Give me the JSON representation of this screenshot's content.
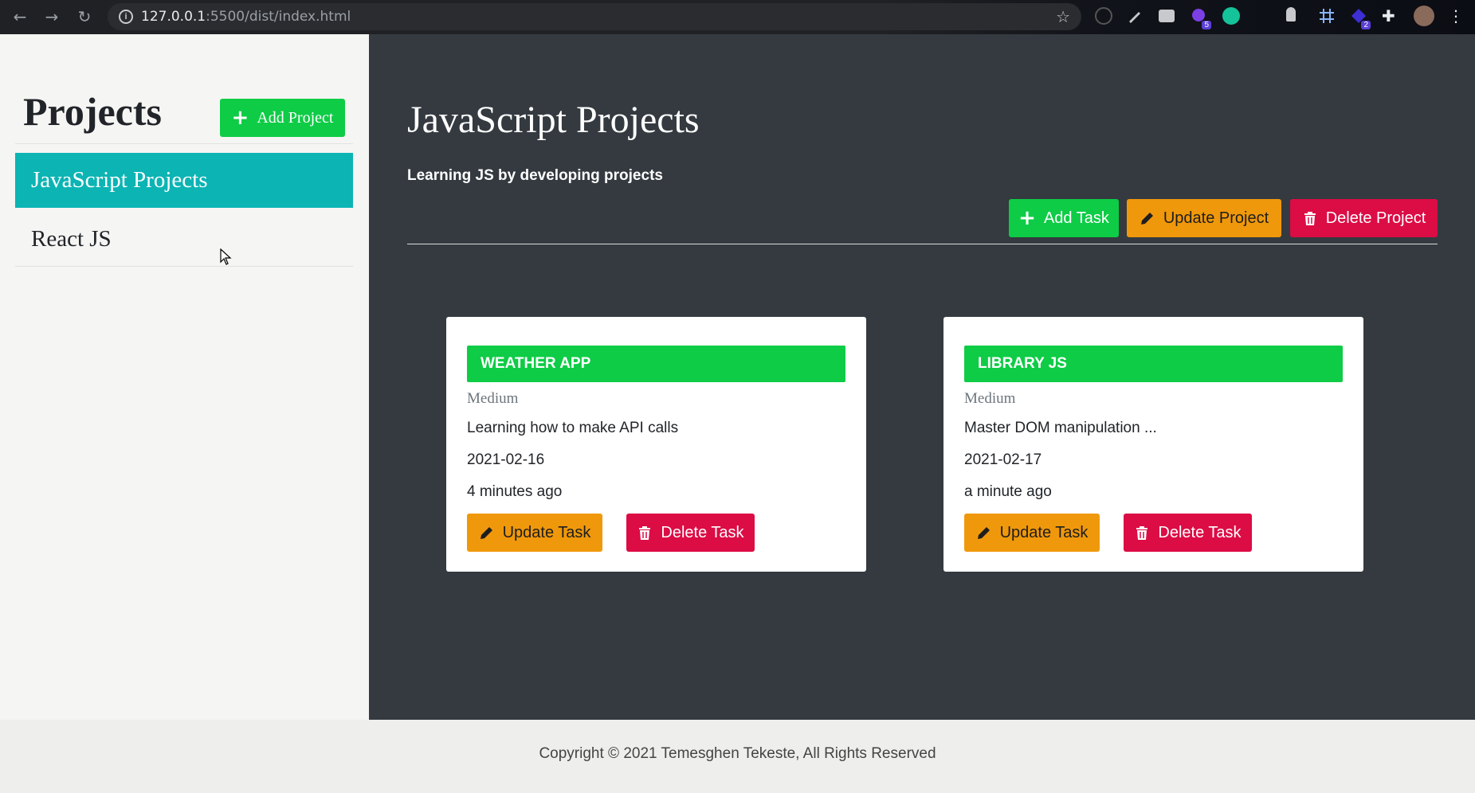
{
  "browser": {
    "url_host": "127.0.0.1",
    "url_path": ":5500/dist/index.html",
    "ext_badges": [
      "5",
      "2"
    ]
  },
  "sidebar": {
    "title": "Projects",
    "add_project_label": "Add Project",
    "items": [
      {
        "label": "JavaScript Projects"
      },
      {
        "label": "React JS"
      }
    ]
  },
  "main": {
    "title": "JavaScript Projects",
    "subtitle": "Learning JS by developing projects",
    "add_task_label": "Add Task",
    "update_project_label": "Update Project",
    "delete_project_label": "Delete Project"
  },
  "tasks": [
    {
      "title": "WEATHER APP",
      "priority": "Medium",
      "description": "Learning how to make API calls",
      "date": "2021-02-16",
      "ago": "4 minutes ago",
      "update_label": "Update Task",
      "delete_label": "Delete Task"
    },
    {
      "title": "LIBRARY JS",
      "priority": "Medium",
      "description": "Master DOM manipulation ...",
      "date": "2021-02-17",
      "ago": "a minute ago",
      "update_label": "Update Task",
      "delete_label": "Delete Task"
    }
  ],
  "footer": {
    "text": "Copyright © 2021 Temesghen Tekeste, All Rights Reserved"
  },
  "colors": {
    "green": "#0ecc46",
    "orange": "#f0980b",
    "red": "#dc0c45",
    "teal": "#0cb4b4",
    "dark": "#343a40"
  }
}
